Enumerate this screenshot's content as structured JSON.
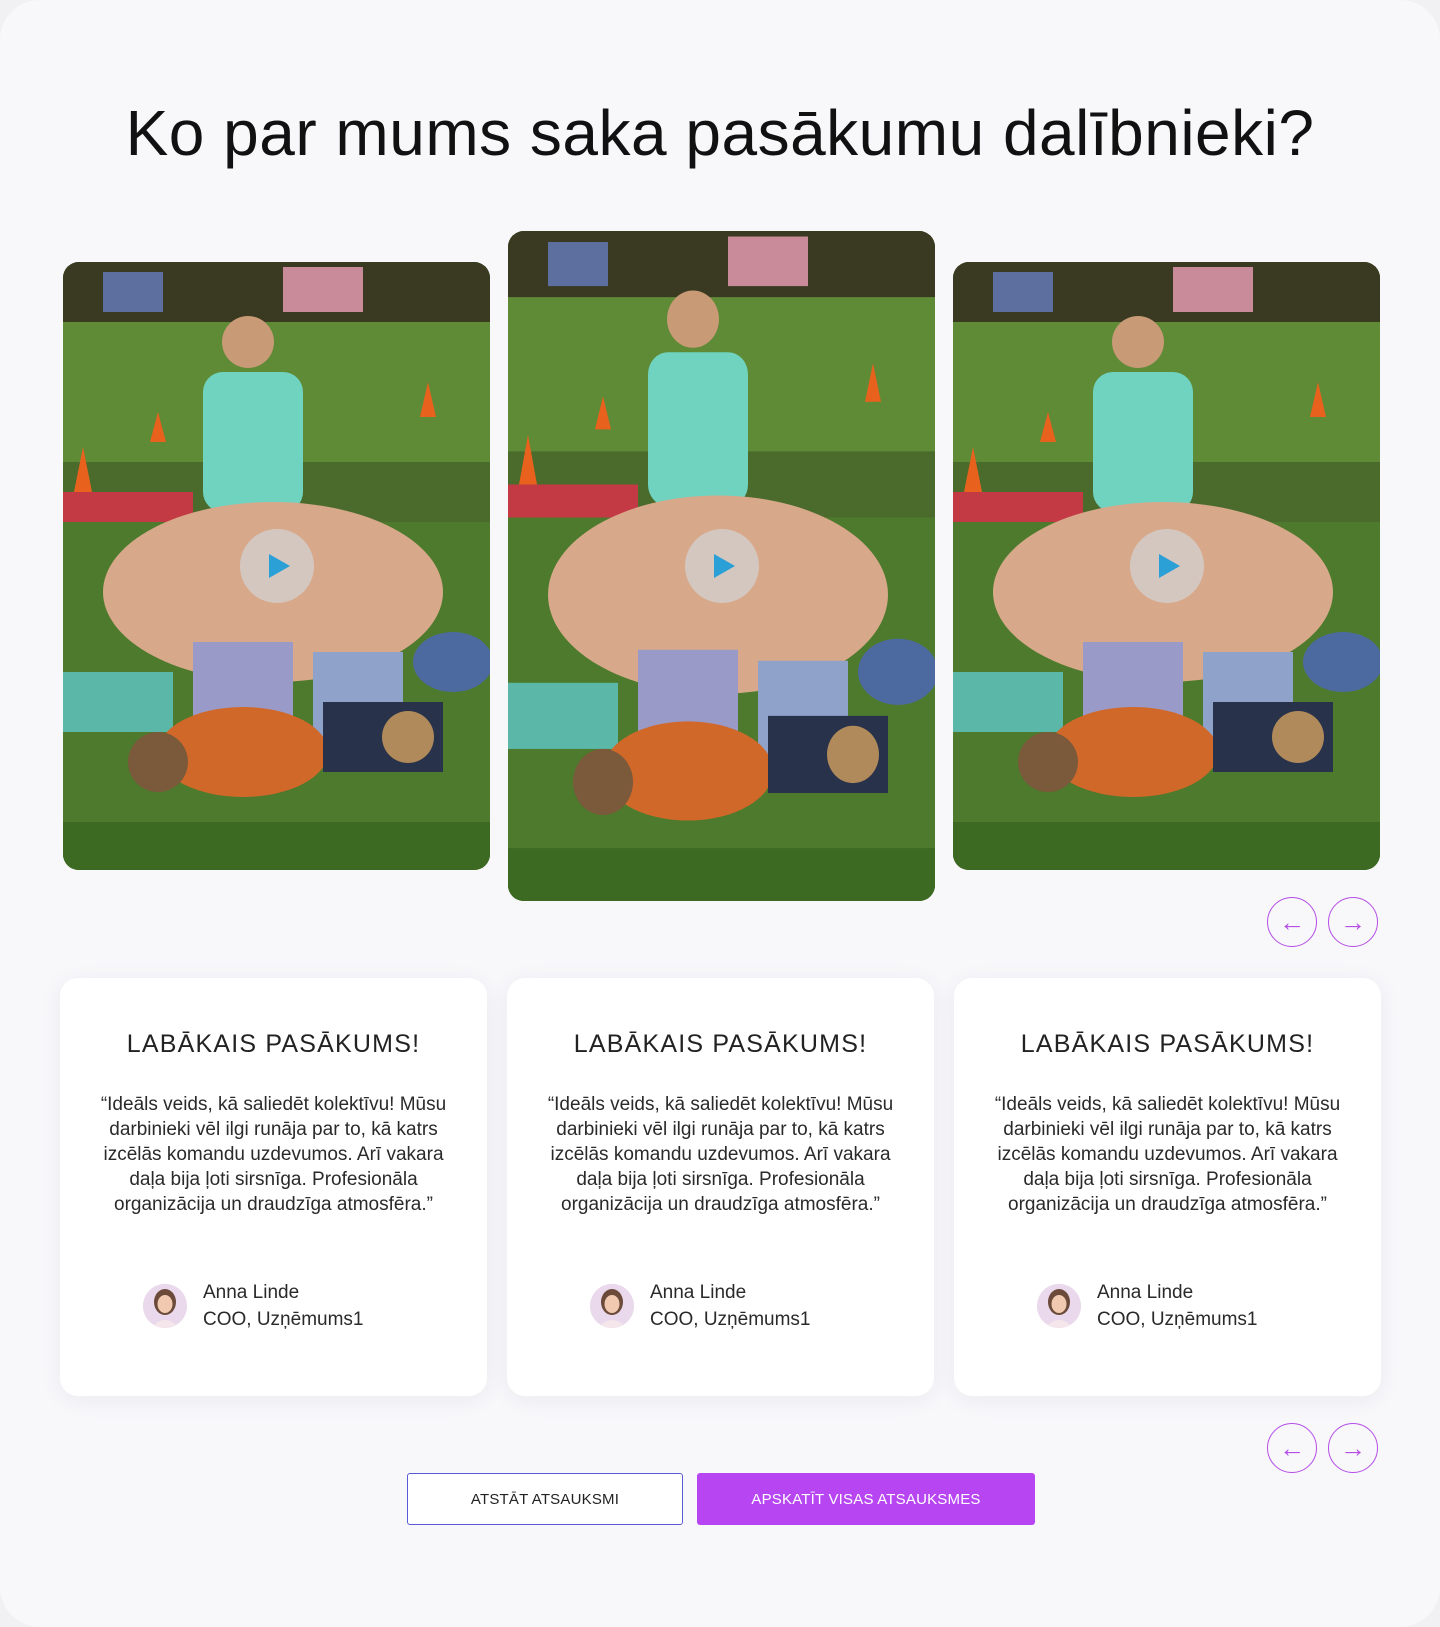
{
  "section": {
    "title": "Ko par mums saka pasākumu dalībnieki?"
  },
  "videos": [
    {
      "play_label": "play-icon"
    },
    {
      "play_label": "play-icon"
    },
    {
      "play_label": "play-icon"
    }
  ],
  "video_nav": {
    "prev_icon": "arrow-left-icon",
    "next_icon": "arrow-right-icon",
    "prev": "←",
    "next": "→"
  },
  "testimonials": [
    {
      "title": "LABĀKAIS PASĀKUMS!",
      "quote": "“Ideāls veids, kā saliedēt kolektīvu! Mūsu darbinieki vēl ilgi runāja par to, kā katrs izcēlās komandu uzdevumos. Arī vakara daļa bija ļoti sirsnīga. Profesionāla organizācija un draudzīga atmosfēra.”",
      "name": "Anna Linde",
      "role": "COO, Uzņēmums1"
    },
    {
      "title": "LABĀKAIS PASĀKUMS!",
      "quote": "“Ideāls veids, kā saliedēt kolektīvu! Mūsu darbinieki vēl ilgi runāja par to, kā katrs izcēlās komandu uzdevumos. Arī vakara daļa bija ļoti sirsnīga. Profesionāla organizācija un draudzīga atmosfēra.”",
      "name": "Anna Linde",
      "role": "COO, Uzņēmums1"
    },
    {
      "title": "LABĀKAIS PASĀKUMS!",
      "quote": "“Ideāls veids, kā saliedēt kolektīvu! Mūsu darbinieki vēl ilgi runāja par to, kā katrs izcēlās komandu uzdevumos. Arī vakara daļa bija ļoti sirsnīga. Profesionāla organizācija un draudzīga atmosfēra.”",
      "name": "Anna Linde",
      "role": "COO, Uzņēmums1"
    }
  ],
  "testimonial_nav": {
    "prev": "←",
    "next": "→"
  },
  "buttons": {
    "leave_review": "ATSTĀT ATSAUKSMI",
    "view_all": "APSKATĪT VISAS ATSAUKSMES"
  },
  "colors": {
    "accent": "#b745f1",
    "outline": "#5a5ad6",
    "background": "#f8f7fa"
  }
}
